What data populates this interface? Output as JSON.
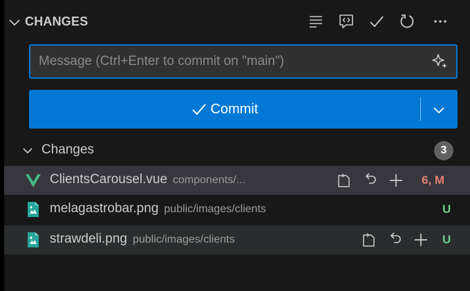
{
  "header": {
    "title": "CHANGES",
    "actions": [
      "view-as-list-icon",
      "show-changes-icon",
      "commit-check-icon",
      "refresh-icon",
      "more-actions-icon"
    ]
  },
  "message": {
    "placeholder": "Message (Ctrl+Enter to commit on \"main\")",
    "value": "",
    "sparkle_icon": "sparkle-icon"
  },
  "commit": {
    "label": "Commit",
    "icon": "check-icon",
    "dropdown_icon": "chevron-down-icon"
  },
  "changes_group": {
    "label": "Changes",
    "count": "3"
  },
  "files": [
    {
      "name": "ClientsCarousel.vue",
      "path": "components/...",
      "status": "6, M",
      "status_color": "#e2816f",
      "icon": "vue-file-icon",
      "state": "selected"
    },
    {
      "name": "melagastrobar.png",
      "path": "public/images/clients",
      "status": "U",
      "status_color": "#73c991",
      "icon": "image-file-icon",
      "state": "normal"
    },
    {
      "name": "strawdeli.png",
      "path": "public/images/clients",
      "status": "U",
      "status_color": "#73c991",
      "icon": "image-file-icon",
      "state": "hover"
    }
  ],
  "colors": {
    "accent": "#0078d4",
    "panel": "#181818",
    "vue_green": "#41b883",
    "image_teal": "#26a69a"
  }
}
